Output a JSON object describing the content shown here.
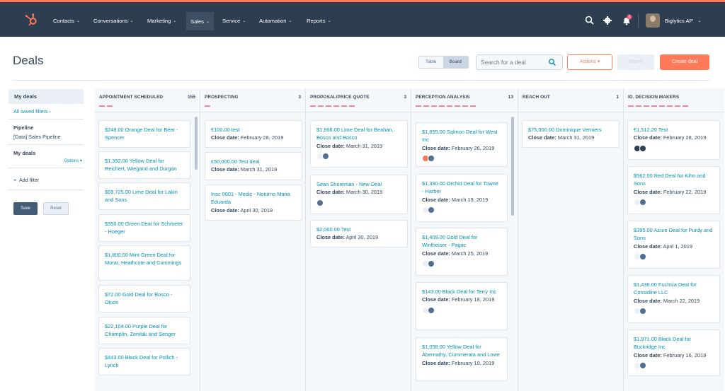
{
  "nav": {
    "items": [
      {
        "label": "Contacts"
      },
      {
        "label": "Conversations"
      },
      {
        "label": "Marketing"
      },
      {
        "label": "Sales"
      },
      {
        "label": "Service"
      },
      {
        "label": "Automation"
      },
      {
        "label": "Reports"
      }
    ],
    "active": "Sales",
    "notification_count": "5",
    "user_name": "Biglytics AP"
  },
  "header": {
    "title": "Deals",
    "view_toggle": [
      "Table",
      "Board"
    ],
    "active_view": "Board",
    "search_placeholder": "Search for a deal",
    "actions_label": "Actions",
    "import_label": "Import",
    "create_label": "Create deal"
  },
  "sidebar": {
    "my_deals": "My deals",
    "all_saved_filters": "All saved filters",
    "pipeline_label": "Pipeline",
    "pipeline_value": "[Data] Sales Pipeline",
    "owner_label": "My deals",
    "options": "Options",
    "add_filter": "Add filter",
    "save": "Save",
    "reset": "Reset"
  },
  "columns": [
    {
      "title": "APPOINTMENT SCHEDULED",
      "count": "155",
      "cards": [
        {
          "name": "$248.00 Orange Deal for Beer - Spencer"
        },
        {
          "name": "$1,392.00 Yellow Deal for Reichert, Wiegand and Durgan"
        },
        {
          "name": "$69,725.00 Lime Deal for Lakin and Sons"
        },
        {
          "name": "$350.00 Green Deal for Schmeler - Hoeger"
        },
        {
          "name": "$1,800.00 Mint Green Deal for Morar, Heathcote and Cummings"
        },
        {
          "name": "$72.00 Gold Deal for Bosco - Olson"
        },
        {
          "name": "$22,104.00 Purple Deal for Champlin, Zemlak and Senger"
        },
        {
          "name": "$443.00 Black Deal for Pollich - Lynch"
        }
      ]
    },
    {
      "title": "PROSPECTING",
      "count": "3",
      "cards": [
        {
          "name": "€100.00 test",
          "close_label": "Close date:",
          "close": "February 28, 2019"
        },
        {
          "name": "£50,000.00 Test deal",
          "close_label": "Close date:",
          "close": "March 31, 2019"
        },
        {
          "name": "Insc 0001 - Medic - Noturno Maria Eduarda",
          "close_label": "Close date:",
          "close": "April 30, 2019"
        }
      ]
    },
    {
      "title": "PROPOSAL/PRICE QUOTE",
      "count": "3",
      "cards": [
        {
          "name": "$1,966.00 Lime Deal for Beahan, Bosco and Bosco",
          "close_label": "Close date:",
          "close": "March 31, 2019"
        },
        {
          "name": "Sean Shoreman - New Deal",
          "close_label": "Close date:",
          "close": "March 30, 2019"
        },
        {
          "name": "$2,000.00 Test",
          "close_label": "Close date:",
          "close": "April 30, 2019"
        }
      ]
    },
    {
      "title": "PERCEPTION ANALYSIS",
      "count": "13",
      "cards": [
        {
          "name": "$1,855.00 Salmon Deal for West Inc",
          "close_label": "Close date:",
          "close": "February 26, 2019"
        },
        {
          "name": "$1,330.00 Orchid Deal for Towne - Harber",
          "close_label": "Close date:",
          "close": "March 19, 2019"
        },
        {
          "name": "$1,409.00 Gold Deal for Wintheiser - Pagac",
          "close_label": "Close date:",
          "close": "March 25, 2019"
        },
        {
          "name": "$143.00 Black Deal for Terry Inc",
          "close_label": "Close date:",
          "close": "February 18, 2019"
        },
        {
          "name": "$1,058.00 Yellow Deal for Abernathy, Cummerata and Lowe",
          "close_label": "Close date:",
          "close": "February 10, 2019"
        }
      ]
    },
    {
      "title": "REACH OUT",
      "count": "1",
      "cards": [
        {
          "name": "$75,000.00 Dominique Verniers",
          "close_label": "Close date:",
          "close": "March 31, 2019"
        }
      ]
    },
    {
      "title": "ID. DECISION MAKERS",
      "count": "",
      "cards": [
        {
          "name": "€1,512.20 Test",
          "close_label": "Close date:",
          "close": "February 28, 2019"
        },
        {
          "name": "$562.00 Red Deal for Kihn and Sons",
          "close_label": "Close date:",
          "close": "February 22, 2019"
        },
        {
          "name": "$395.00 Azure Deal for Purdy and Sons",
          "close_label": "Close date:",
          "close": "April 1, 2019"
        },
        {
          "name": "$1,436.00 Fuchsia Deal for Considine LLC",
          "close_label": "Close date:",
          "close": "March 22, 2019"
        },
        {
          "name": "$1,971.00 Black Deal for Buckridge Inc",
          "close_label": "Close date:",
          "close": "February 16, 2019"
        }
      ]
    }
  ],
  "colors": {
    "nav_bg": "#2d3e50",
    "accent": "#ff7a59",
    "link": "#0091ae",
    "board_bg": "#f5f8fa"
  }
}
